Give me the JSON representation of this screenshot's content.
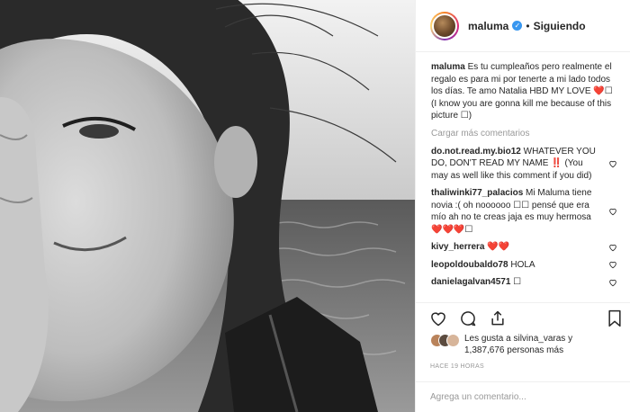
{
  "post": {
    "username": "maluma",
    "verified_glyph": "✓",
    "dot": "•",
    "follow_status": "Siguiendo"
  },
  "caption": {
    "username": "maluma",
    "text": "Es tu cumpleaños pero realmente el regalo es para mi por tenerte a mi lado todos los días. Te amo Natalia HBD MY LOVE ❤️☐ (I know you are gonna kill me because of this picture ☐)"
  },
  "load_more_label": "Cargar más comentarios",
  "comments": [
    {
      "user": "do.not.read.my.bio12",
      "text": "WHATEVER YOU DO, DON'T READ MY NAME ‼️ (You may as well like this comment if you did)"
    },
    {
      "user": "thaliwinki77_palacios",
      "text": "Mi Maluma tiene novia :( oh noooooo ☐☐ pensé que era mío ah no te creas jaja es muy hermosa❤️❤️❤️☐"
    },
    {
      "user": "kivy_herrera",
      "text": "❤️❤️"
    },
    {
      "user": "leopoldoubaldo78",
      "text": "HOLA"
    },
    {
      "user": "danielagalvan4571",
      "text": "☐"
    }
  ],
  "actions": {
    "like_icon": "heart-outline-icon",
    "comment_icon": "comment-bubble-icon",
    "share_icon": "share-icon",
    "save_icon": "bookmark-icon"
  },
  "likes": {
    "line1": "Les gusta a silvina_varas y",
    "line2": "1,387,676 personas más"
  },
  "timestamp": "HACE 19 HORAS",
  "add_comment": {
    "placeholder": "Agrega un comentario..."
  },
  "colors": {
    "verified": "#3897f0",
    "border": "#efefef",
    "muted": "#999999",
    "text": "#262626"
  }
}
